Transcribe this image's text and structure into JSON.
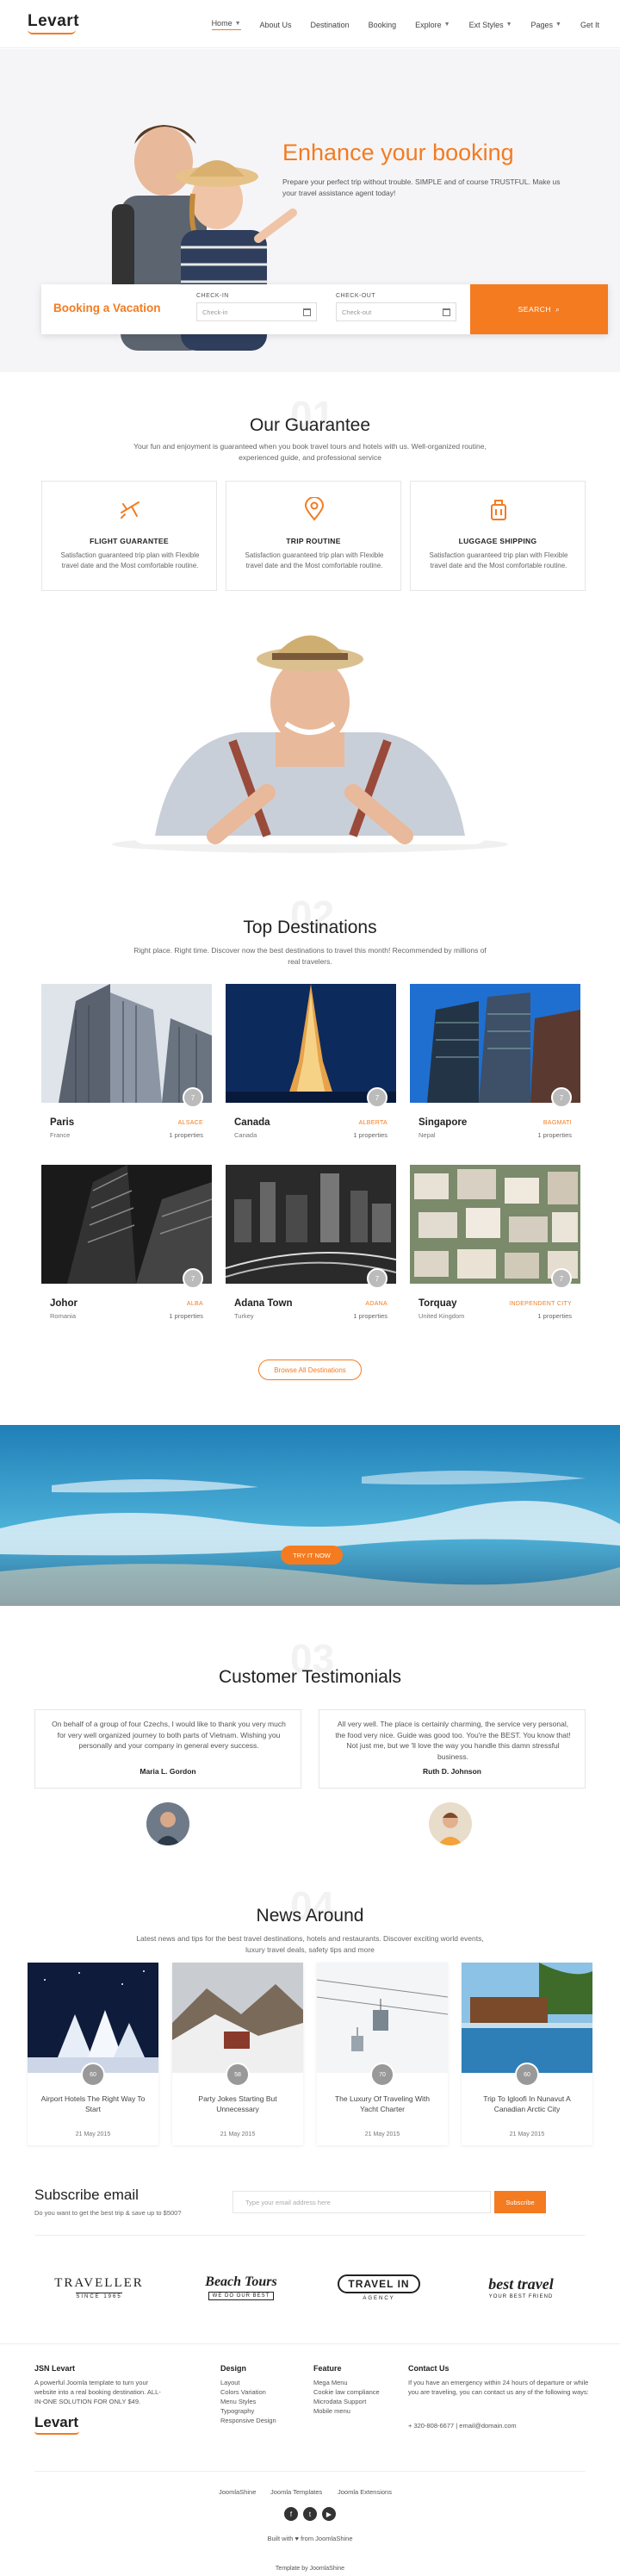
{
  "header": {
    "logo": "Levart",
    "nav": [
      {
        "label": "Home",
        "caret": true
      },
      {
        "label": "About Us",
        "caret": false
      },
      {
        "label": "Destination",
        "caret": false
      },
      {
        "label": "Booking",
        "caret": false
      },
      {
        "label": "Explore",
        "caret": true
      },
      {
        "label": "Ext Styles",
        "caret": true
      },
      {
        "label": "Pages",
        "caret": true
      },
      {
        "label": "Get It",
        "caret": false
      }
    ]
  },
  "hero": {
    "title": "Enhance your booking",
    "text": "Prepare your perfect trip without trouble. SIMPLE and of course TRUSTFUL. Make us your travel assistance agent today!"
  },
  "booking": {
    "label": "Booking a Vacation",
    "checkin_label": "CHECK-IN",
    "checkin_placeholder": "Check-in",
    "checkout_label": "CHECK-OUT",
    "checkout_placeholder": "Check-out",
    "search_label": "SEARCH"
  },
  "guarantee": {
    "number": "01",
    "title": "Our Guarantee",
    "subtitle": "Your fun and enjoyment is guaranteed when you book travel tours and hotels with us. Well-organized routine, experienced guide, and professional service",
    "cards": [
      {
        "icon": "plane-icon",
        "title": "FLIGHT GUARANTEE",
        "text": "Satisfaction guaranteed trip plan with Flexible travel date and the Most comfortable routine."
      },
      {
        "icon": "location-pin-icon",
        "title": "TRIP ROUTINE",
        "text": "Satisfaction guaranteed trip plan with Flexible travel date and the Most comfortable routine."
      },
      {
        "icon": "luggage-icon",
        "title": "LUGGAGE SHIPPING",
        "text": "Satisfaction guaranteed trip plan with Flexible travel date and the Most comfortable routine."
      }
    ]
  },
  "destinations": {
    "number": "02",
    "title": "Top Destinations",
    "subtitle": "Right place. Right time. Discover now the best destinations to travel this month! Recommended by millions of real travelers.",
    "cards": [
      {
        "name": "Paris",
        "country": "France",
        "region": "ALSACE",
        "props": "1 properties",
        "badge": "7"
      },
      {
        "name": "Canada",
        "country": "Canada",
        "region": "ALBERTA",
        "props": "1 properties",
        "badge": "7"
      },
      {
        "name": "Singapore",
        "country": "Nepal",
        "region": "BAGMATI",
        "props": "1 properties",
        "badge": "7"
      },
      {
        "name": "Johor",
        "country": "Romania",
        "region": "ALBA",
        "props": "1 properties",
        "badge": "7"
      },
      {
        "name": "Adana Town",
        "country": "Turkey",
        "region": "ADANA",
        "props": "1 properties",
        "badge": "7"
      },
      {
        "name": "Torquay",
        "country": "United Kingdom",
        "region": "INDEPENDENT CITY",
        "props": "1 properties",
        "badge": "7"
      }
    ],
    "browse_label": "Browse All Destinations"
  },
  "banner": {
    "button_label": "TRY IT NOW"
  },
  "testimonials": {
    "number": "03",
    "title": "Customer Testimonials",
    "items": [
      {
        "text": "On behalf of a group of four Czechs, I would like to thank you very much for very well organized journey to both parts of Vietnam. Wishing you personally and your company in general every success.",
        "author": "Maria L. Gordon"
      },
      {
        "text": "All very well. The place is certainly charming, the service very personal, the food very nice. Guide was good too. You're the BEST. You know that! Not just me, but we 'll love the way you handle this damn stressful business.",
        "author": "Ruth D. Johnson"
      }
    ]
  },
  "news": {
    "number": "04",
    "title": "News Around",
    "subtitle": "Latest news and tips for the best travel destinations, hotels and restaurants. Discover exciting world events, luxury travel deals, safety tips and more",
    "items": [
      {
        "title": "Airport Hotels The Right Way To Start",
        "date": "21 May 2015",
        "views": "60"
      },
      {
        "title": "Party Jokes Starting But Unnecessary",
        "date": "21 May 2015",
        "views": "58"
      },
      {
        "title": "The Luxury Of Traveling With Yacht Charter",
        "date": "21 May 2015",
        "views": "70"
      },
      {
        "title": "Trip To Igloofi In Nunavut A Canadian Arctic City",
        "date": "21 May 2015",
        "views": "60"
      }
    ]
  },
  "subscribe": {
    "title": "Subscribe email",
    "text": "Do you want to get the best trip & save up to $500?",
    "placeholder": "Type your email address here",
    "button": "Subscribe"
  },
  "brands": [
    {
      "name": "TRAVELLER",
      "sub": "SINCE 1965"
    },
    {
      "name": "Beach Tours",
      "sub": "WE DO OUR BEST"
    },
    {
      "name": "TRAVEL IN",
      "sub": "AGENCY"
    },
    {
      "name": "best travel",
      "sub": "YOUR BEST FRIEND"
    }
  ],
  "footer": {
    "about_title": "JSN Levart",
    "about_text": "A powerful Joomla template to turn your website into a real booking destination. ALL-IN-ONE SOLUTION FOR ONLY $49.",
    "logo": "Levart",
    "design_title": "Design",
    "design_links": [
      "Layout",
      "Colors Variation",
      "Menu Styles",
      "Typography",
      "Responsive Design"
    ],
    "feature_title": "Feature",
    "feature_links": [
      "Mega Menu",
      "Cookie law compliance",
      "Microdata Support",
      "Mobile menu"
    ],
    "contact_title": "Contact Us",
    "contact_text": "If you have an emergency within 24 hours of departure or while you are traveling, you can contact us any of the following ways:",
    "contact_line": "+ 320-808-6677 | email@domain.com",
    "bottom_links": [
      "JoomlaShine",
      "Joomla Templates",
      "Joomla Extensions"
    ],
    "built": "Built with ♥ from JoomlaShine",
    "template": "Template by JoomlaShine"
  }
}
